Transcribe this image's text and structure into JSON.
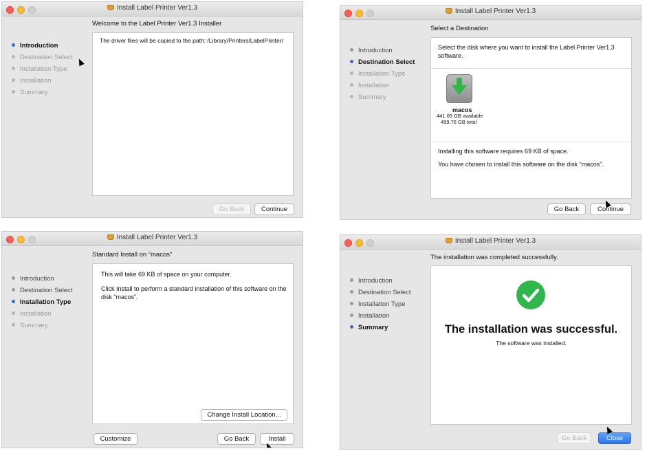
{
  "window_title": "Install Label Printer Ver1.3",
  "steps": [
    "Introduction",
    "Destination Select",
    "Installation Type",
    "Installation",
    "Summary"
  ],
  "intro": {
    "heading": "Welcome to the Label Printer Ver1.3 Installer",
    "body": "The driver files will be copied to the path: /Library/Printers/LabelPrinter/",
    "back": "Go Back",
    "continue": "Continue"
  },
  "destination": {
    "heading": "Select a Destination",
    "prompt": "Select the disk where you want to install the Label Printer Ver1.3 software.",
    "disk_name": "macos",
    "disk_available": "441.05 GB available",
    "disk_total": "499.76 GB total",
    "requires": "Installing this software requires 69 KB of space.",
    "chosen": "You have chosen to install this software on the disk “macos”.",
    "back": "Go Back",
    "continue": "Continue"
  },
  "type": {
    "heading": "Standard Install on “macos”",
    "line1": "This will take 69 KB of space on your computer.",
    "line2": "Click Install to perform a standard installation of this software on the disk “macos”.",
    "change_location": "Change Install Location...",
    "customize": "Customize",
    "back": "Go Back",
    "install": "Install"
  },
  "summary": {
    "heading": "The installation was completed successfully.",
    "big": "The installation was successful.",
    "small": "The software was installed.",
    "back": "Go Back",
    "close": "Close"
  },
  "colors": {
    "accent": "#2f6fd6",
    "success": "#2fb74b"
  }
}
